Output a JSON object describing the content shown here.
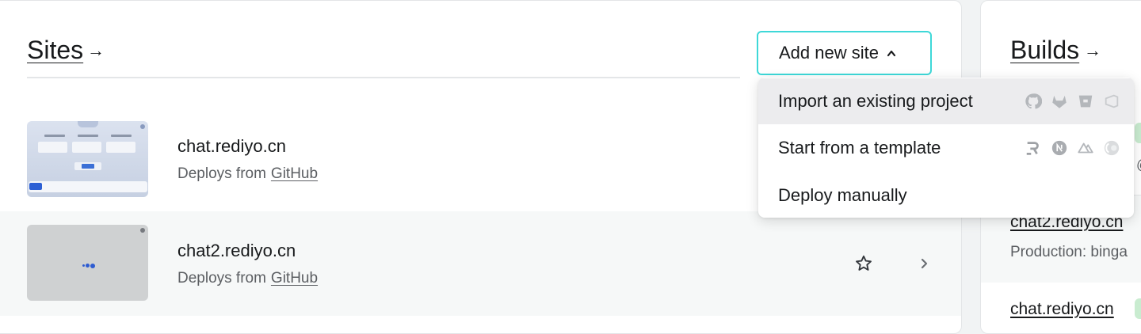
{
  "sites": {
    "title": "Sites",
    "arrow": "→",
    "add_button": {
      "label": "Add new site",
      "caret": "⌃"
    },
    "rows": [
      {
        "name": "chat.rediyo.cn",
        "deploys_prefix": "Deploys from",
        "deploys_source": "GitHub"
      },
      {
        "name": "chat2.rediyo.cn",
        "deploys_prefix": "Deploys from",
        "deploys_source": "GitHub"
      }
    ]
  },
  "dropdown": {
    "items": [
      {
        "label": "Import an existing project",
        "icons": [
          "github-icon",
          "gitlab-icon",
          "bitbucket-icon",
          "azure-devops-icon"
        ]
      },
      {
        "label": "Start from a template",
        "icons": [
          "remix-icon",
          "nextjs-icon",
          "nuxt-icon",
          "astro-icon"
        ]
      },
      {
        "label": "Deploy manually",
        "icons": []
      }
    ]
  },
  "builds": {
    "title": "Builds",
    "arrow": "→",
    "items": [
      {
        "name": "chat2.rediyo.cn",
        "detail": "Production: binga"
      },
      {
        "name": "chat.rediyo.cn",
        "detail": ""
      }
    ],
    "partial_symbol": "@"
  },
  "colors": {
    "accent_border": "#3ed8d8",
    "menu_hover": "#ececee",
    "status_green": "#c9ecd0"
  }
}
